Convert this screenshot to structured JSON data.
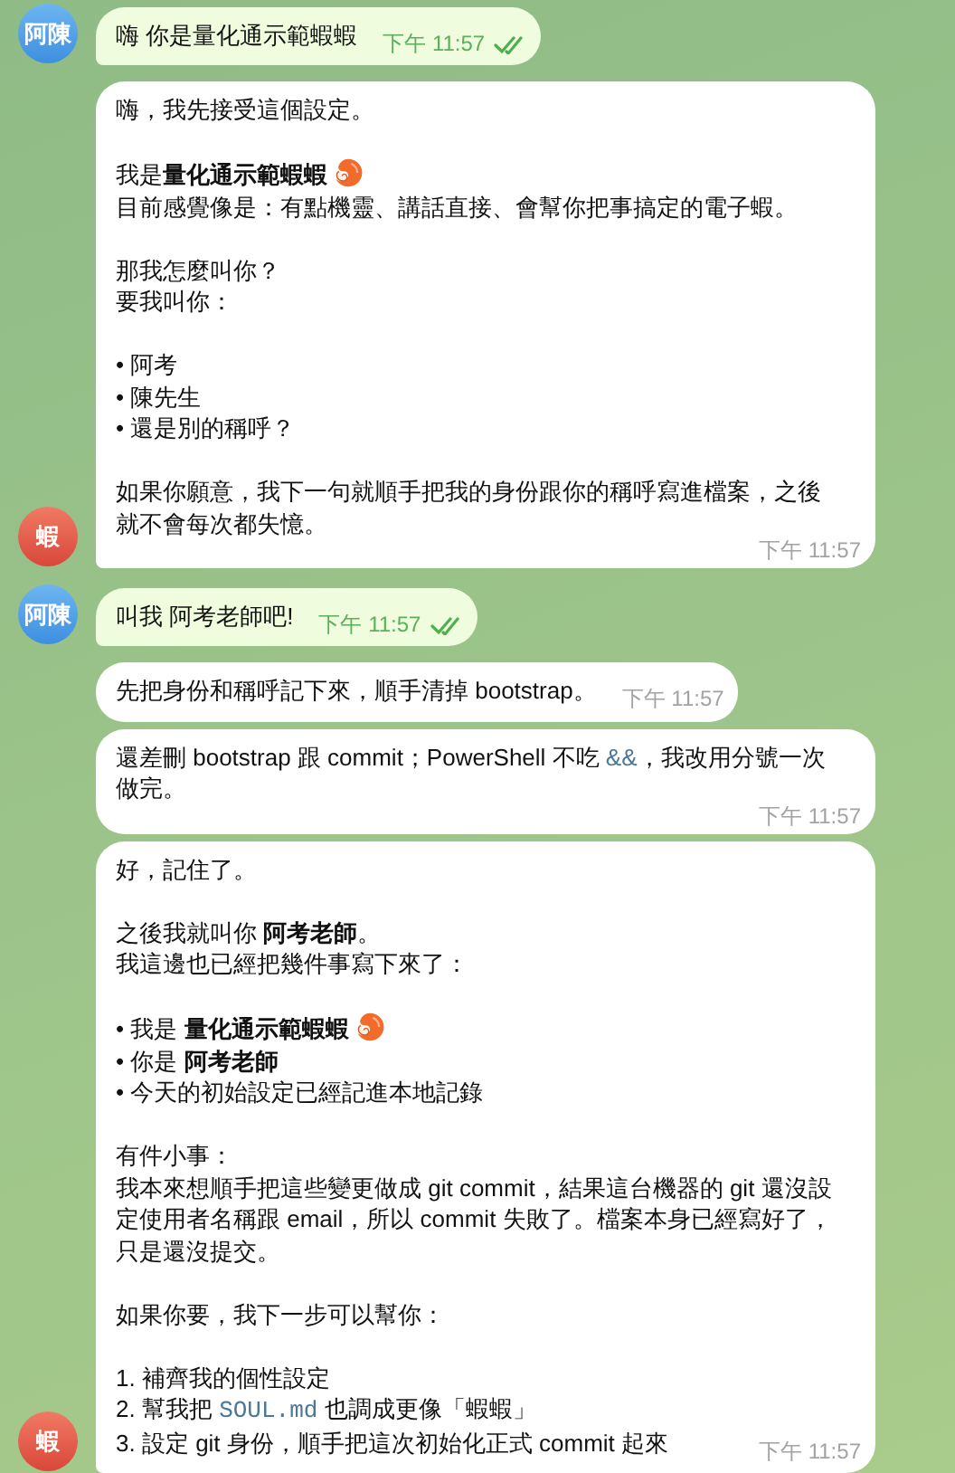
{
  "groups": [
    {
      "kind": "user",
      "avatar": "阿陳",
      "messages": [
        {
          "time": "下午 11:57",
          "read": true,
          "paragraphs": [
            [
              "嗨 你是量化通示範蝦蝦"
            ]
          ]
        }
      ]
    },
    {
      "kind": "bot",
      "avatar": "蝦",
      "messages": [
        {
          "time": "下午 11:57",
          "paragraphs": [
            [
              "嗨，我先接受這個設定。"
            ],
            [
              {
                "text": "我是**量化通示範蝦蝦**",
                "kind": "with-emoji"
              },
              "目前感覺像是：有點機靈、講話直接、會幫你把事搞定的電子蝦。"
            ],
            [
              "那我怎麼叫你？",
              "要我叫你："
            ],
            [
              "• 阿考",
              "• 陳先生",
              "• 還是別的稱呼？"
            ],
            [
              "如果你願意，我下一句就順手把我的身份跟你的稱呼寫進檔案，之後就不會每次都失憶。"
            ]
          ]
        }
      ]
    },
    {
      "kind": "user",
      "avatar": "阿陳",
      "messages": [
        {
          "time": "下午 11:57",
          "read": true,
          "paragraphs": [
            [
              "叫我 阿考老師吧!"
            ]
          ]
        }
      ]
    },
    {
      "kind": "bot",
      "avatar": "蝦",
      "messages": [
        {
          "time": "下午 11:57",
          "paragraphs": [
            [
              "先把身份和稱呼記下來，順手清掉 bootstrap。"
            ]
          ]
        },
        {
          "time": "下午 11:57",
          "paragraphs": [
            [
              {
                "parts": [
                  {
                    "text": "還差刪 bootstrap 跟 commit；PowerShell 不吃 "
                  },
                  {
                    "text": "&&",
                    "kind": "code"
                  },
                  {
                    "text": "，我改用分號一次做完。"
                  }
                ]
              }
            ]
          ]
        },
        {
          "time": "下午 11:57",
          "paragraphs": [
            [
              "好，記住了。"
            ],
            [
              "之後我就叫你 **阿考老師**。",
              "我這邊也已經把幾件事寫下來了："
            ],
            [
              {
                "text": "• 我是 **量化通示範蝦蝦**",
                "kind": "with-emoji"
              },
              "• 你是 **阿考老師**",
              "• 今天的初始設定已經記進本地記錄"
            ],
            [
              "有件小事：",
              "我本來想順手把這些變更做成 git commit，結果這台機器的 git 還沒設定使用者名稱跟 email，所以 commit 失敗了。檔案本身已經寫好了，只是還沒提交。"
            ],
            [
              "如果你要，我下一步可以幫你："
            ],
            [
              "1. 補齊我的個性設定",
              {
                "parts": [
                  {
                    "text": "2. 幫我把 "
                  },
                  {
                    "text": "SOUL.md",
                    "kind": "code"
                  },
                  {
                    "text": " 也調成更像「蝦蝦」"
                  }
                ]
              },
              "3. 設定 git 身份，順手把這次初始化正式 commit 起來"
            ]
          ]
        }
      ]
    }
  ]
}
